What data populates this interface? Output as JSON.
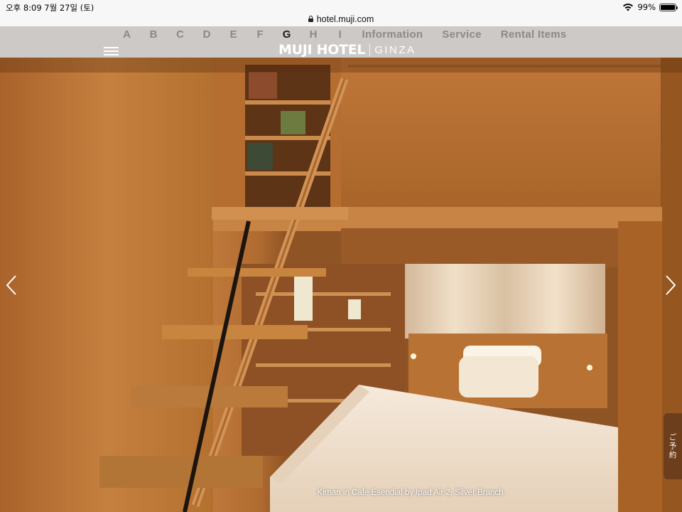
{
  "status_bar": {
    "time_date": "오후 8:09   7월 27일 (토)",
    "battery": "99%",
    "battery_level": 0.99,
    "icons": [
      "wifi-icon",
      "battery-icon"
    ]
  },
  "browser": {
    "url": "hotel.muji.com"
  },
  "nav": {
    "letters": [
      "A",
      "B",
      "C",
      "D",
      "E",
      "F",
      "G",
      "H",
      "I"
    ],
    "active_letter": "G",
    "links": [
      "Information",
      "Service",
      "Rental Items"
    ]
  },
  "brand": {
    "name": "MUJI HOTEL",
    "location": "GINZA"
  },
  "hero": {
    "caption": "Kirnan in Cafe Esendial by Ipad Air 2, Silver Branch"
  },
  "reserve": {
    "label": "ご予約"
  },
  "colors": {
    "header_bg": "#cdcdcd",
    "nav_inactive": "#8a8a8a",
    "nav_active": "#1a1a1a",
    "wood": "#b86a2c"
  }
}
